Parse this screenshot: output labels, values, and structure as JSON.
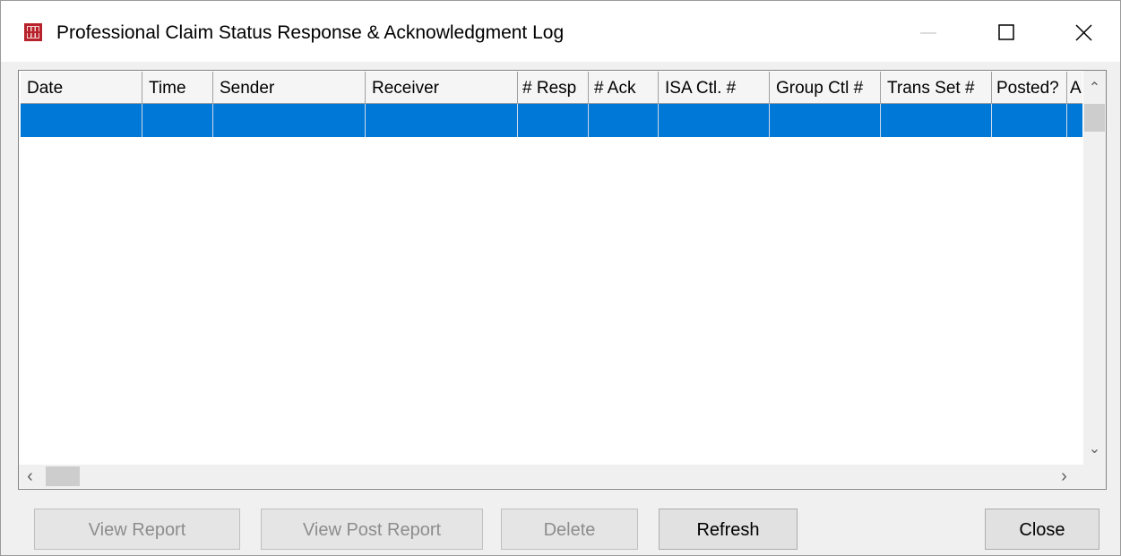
{
  "window": {
    "title": "Professional Claim Status Response & Acknowledgment Log",
    "icon": "app-log-icon",
    "accent": "#0078d7"
  },
  "grid": {
    "columns": [
      "Date",
      "Time",
      "Sender",
      "Receiver",
      "# Resp",
      "# Ack",
      "ISA Ctl. #",
      "Group Ctl #",
      "Trans Set #",
      "Posted?",
      "A"
    ],
    "rows": []
  },
  "buttons": {
    "view_report": "View Report",
    "view_post_report": "View Post Report",
    "delete": "Delete",
    "refresh": "Refresh",
    "close": "Close"
  }
}
